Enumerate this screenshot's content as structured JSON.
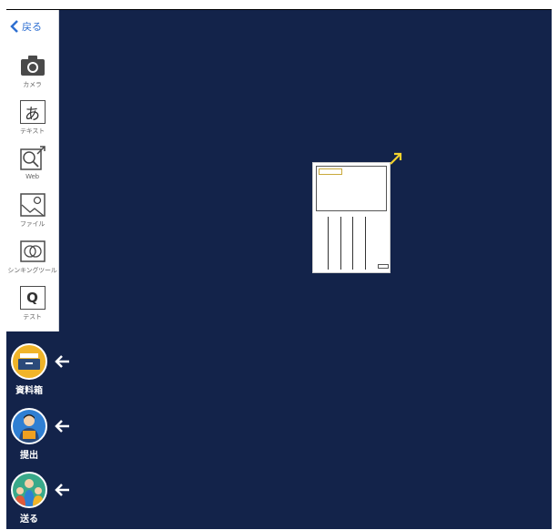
{
  "toolbar": {
    "back_label": "戻る",
    "tools": [
      {
        "label": "カメラ",
        "icon": "camera-icon"
      },
      {
        "label": "テキスト",
        "icon": "text-icon",
        "glyph": "あ"
      },
      {
        "label": "Web",
        "icon": "web-search-icon"
      },
      {
        "label": "ファイル",
        "icon": "file-image-icon"
      },
      {
        "label": "シンキングツール",
        "icon": "thinking-tool-icon"
      },
      {
        "label": "テスト",
        "icon": "test-icon",
        "glyph": "Q"
      }
    ]
  },
  "side_actions": [
    {
      "label": "資料箱",
      "icon": "material-box-icon",
      "color": "#f0b429"
    },
    {
      "label": "提出",
      "icon": "submit-person-icon",
      "color": "#2f7fd3"
    },
    {
      "label": "送る",
      "icon": "send-people-icon",
      "color": "#39a98a"
    }
  ],
  "canvas": {
    "background": "#13234a",
    "card_accent": "#f2d22e"
  }
}
